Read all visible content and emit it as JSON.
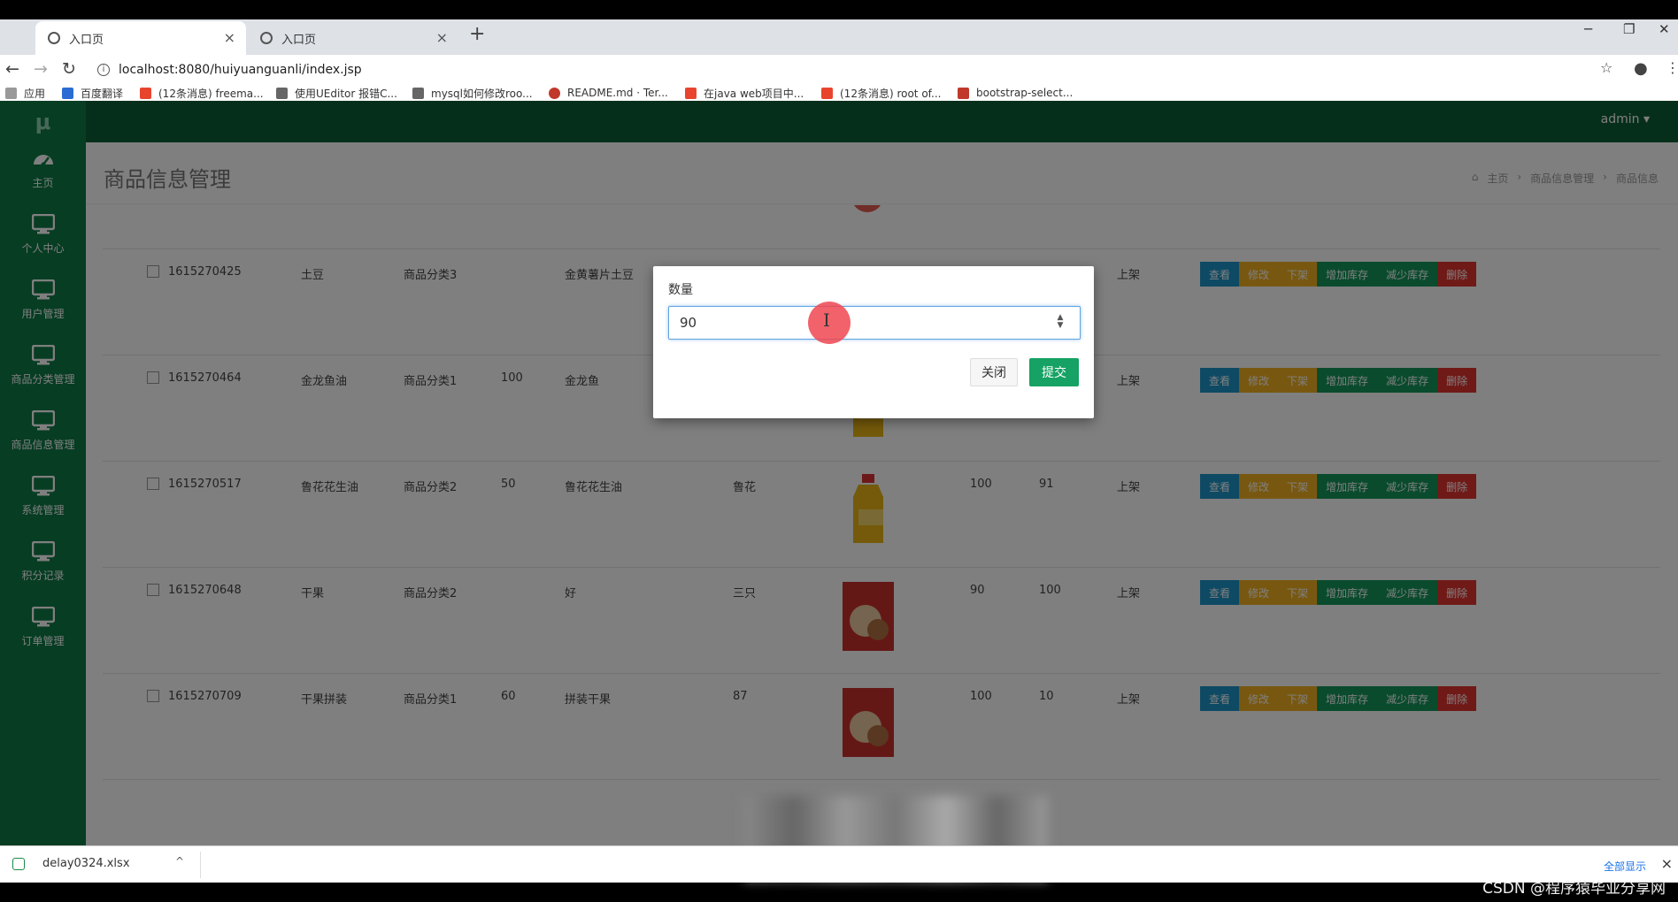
{
  "browser": {
    "tabs": [
      {
        "label": "入口页",
        "active": true
      },
      {
        "label": "入口页",
        "active": false
      }
    ],
    "url": "localhost:8080/huiyuanguanli/index.jsp",
    "bookmarks": [
      "应用",
      "百度翻译",
      "(12条消息) freema...",
      "使用UEditor 报错C...",
      "mysql如何修改roo...",
      "README.md · Ter...",
      "在java web项目中...",
      "(12条消息) root of...",
      "bootstrap-select..."
    ]
  },
  "app": {
    "logo": "μ",
    "user": "admin ▾",
    "nav": [
      {
        "label": "主页",
        "icon": "dashboard-icon"
      },
      {
        "label": "个人中心",
        "icon": "monitor-icon"
      },
      {
        "label": "用户管理",
        "icon": "monitor-icon"
      },
      {
        "label": "商品分类管理",
        "icon": "monitor-icon"
      },
      {
        "label": "商品信息管理",
        "icon": "monitor-icon"
      },
      {
        "label": "系统管理",
        "icon": "monitor-icon"
      },
      {
        "label": "积分记录",
        "icon": "monitor-icon"
      },
      {
        "label": "订单管理",
        "icon": "monitor-icon"
      }
    ],
    "page_title": "商品信息管理",
    "breadcrumb": [
      "主页",
      "商品信息管理",
      "商品信息"
    ]
  },
  "table": {
    "rows": [
      {
        "id": "",
        "name": "",
        "category": "",
        "qty": "",
        "desc": "",
        "c1": "",
        "c2": "",
        "price": "",
        "stock": "",
        "status": "",
        "image": "apple"
      },
      {
        "id": "1615270425",
        "name": "土豆",
        "category": "商品分类3",
        "qty": "",
        "desc": "金黄薯片土豆",
        "c1": "",
        "c2": "",
        "price": "",
        "stock": "",
        "status": "上架",
        "image": "none"
      },
      {
        "id": "1615270464",
        "name": "金龙鱼油",
        "category": "商品分类1",
        "qty": "100",
        "desc": "金龙鱼",
        "c1": "",
        "c2": "",
        "price": "",
        "stock": "",
        "status": "上架",
        "image": "oil"
      },
      {
        "id": "1615270517",
        "name": "鲁花花生油",
        "category": "商品分类2",
        "qty": "50",
        "desc": "鲁花花生油",
        "c1": "",
        "c2": "鲁花",
        "price": "100",
        "stock": "91",
        "status": "上架",
        "image": "oil"
      },
      {
        "id": "1615270648",
        "name": "干果",
        "category": "商品分类2",
        "qty": "",
        "desc": "好",
        "c1": "",
        "c2": "三只",
        "price": "90",
        "stock": "100",
        "status": "上架",
        "image": "snack"
      },
      {
        "id": "1615270709",
        "name": "干果拼装",
        "category": "商品分类1",
        "qty": "60",
        "desc": "拼装干果",
        "c1": "",
        "c2": "87",
        "price": "100",
        "stock": "10",
        "status": "上架",
        "image": "snack"
      }
    ],
    "actions": [
      "查看",
      "修改",
      "下架",
      "增加库存",
      "减少库存",
      "删除"
    ]
  },
  "modal": {
    "label": "数量",
    "value": "90",
    "close_label": "关闭",
    "submit_label": "提交"
  },
  "downloads": {
    "file": "delay0324.xlsx",
    "show_all": "全部显示"
  },
  "watermark": "CSDN @程序猿毕业分享网",
  "colors": {
    "sidebar": "#0f7a47",
    "topbar": "#0d5e37",
    "submit": "#16a264",
    "view": "#1c94c8",
    "edit": "#f0b022",
    "stock": "#14975a",
    "delete": "#e0342e"
  }
}
